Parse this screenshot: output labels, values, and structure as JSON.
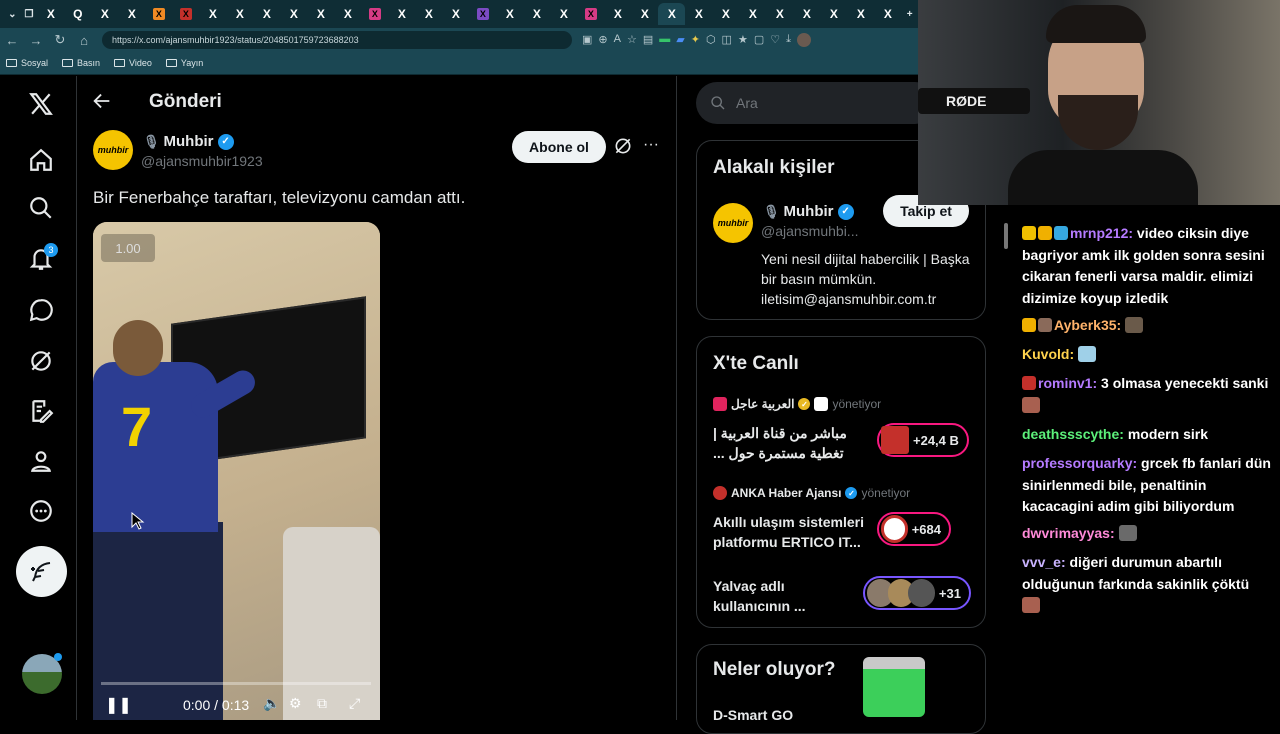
{
  "browser": {
    "tabs": [
      "X",
      "Q",
      "X",
      "X",
      "X",
      "X",
      "X",
      "X",
      "X",
      "X",
      "X",
      "X",
      "X",
      "X",
      "X",
      "X",
      "X",
      "X",
      "X",
      "X",
      "X",
      "X",
      "X",
      "X",
      "X",
      "X",
      "X",
      "X",
      "X",
      "X",
      "X",
      "X"
    ],
    "url": "https://x.com/ajansmuhbir1923/status/2048501759723688203",
    "bookmarks": [
      "Sosyal",
      "Basın",
      "Video",
      "Yayın"
    ]
  },
  "nav": {
    "notifications_count": "3"
  },
  "post": {
    "header_title": "Gönderi",
    "author_name": "Muhbir",
    "author_handle": "@ajansmuhbir1923",
    "avatar_text": "muhbir",
    "subscribe_label": "Abone ol",
    "text": "Bir Fenerbahçe taraftarı, televizyonu camdan attı.",
    "video": {
      "speed": "1.00",
      "time": "0:00 / 0:13",
      "progress": 0.0,
      "jersey_number": "7"
    }
  },
  "sidebar": {
    "search_placeholder": "Ara",
    "relevant_people": {
      "title": "Alakalı kişiler",
      "name": "Muhbir",
      "handle": "@ajansmuhbi...",
      "avatar_text": "muhbir",
      "follow_label": "Takip et",
      "bio": "Yeni nesil dijital habercilik | Başka bir basın mümkün. iletisim@ajansmuhbir.com.tr"
    },
    "live": {
      "title": "X'te Canlı",
      "items": [
        {
          "account": "العربية عاجل",
          "host": "yönetiyor",
          "title": "مباشر من قناة العربية | تغطية مستمرة حول ...",
          "count": "+24,4 B",
          "color": "#e0245e"
        },
        {
          "account": "ANKA Haber Ajansı",
          "host": "yönetiyor",
          "title": "Akıllı ulaşım sistemleri platformu ERTICO IT...",
          "count": "+684",
          "color": "#c4302b"
        },
        {
          "account": "",
          "host": "",
          "title": "Yalvaç adlı kullanıcının ...",
          "count": "+31",
          "color": "#7856ff"
        }
      ]
    },
    "trending": {
      "title": "Neler oluyor?",
      "first_item": "D-Smart GO"
    }
  },
  "stream": {
    "webcam_mic_label": "RØDE",
    "chat": [
      {
        "user": "mrnp212",
        "color": "#b57bff",
        "text": "video ciksin diye bagriyor amk ilk golden sonra sesini cikaran fenerli varsa maldir. elimizi dizimize koyup izledik"
      },
      {
        "user": "Ayberk35",
        "color": "#ffb36b",
        "text": ""
      },
      {
        "user": "Kuvold",
        "color": "#ffd34d",
        "text": ""
      },
      {
        "user": "rominv1",
        "color": "#b57bff",
        "text": "3 olmasa yenecekti sanki"
      },
      {
        "user": "deathssscythe",
        "color": "#5cf07a",
        "text": "modern sirk"
      },
      {
        "user": "professorquarky",
        "color": "#b57bff",
        "text": "grcek fb fanlari dün sinirlenmedi bile, penaltinin kacacagini adim gibi biliyordum"
      },
      {
        "user": "dwvrimayyas",
        "color": "#ff8ad8",
        "text": ""
      },
      {
        "user": "vvv_e",
        "color": "#c9b3ff",
        "text": "diğeri durumun abartılı olduğunun farkında sakinlik çöktü"
      }
    ]
  }
}
